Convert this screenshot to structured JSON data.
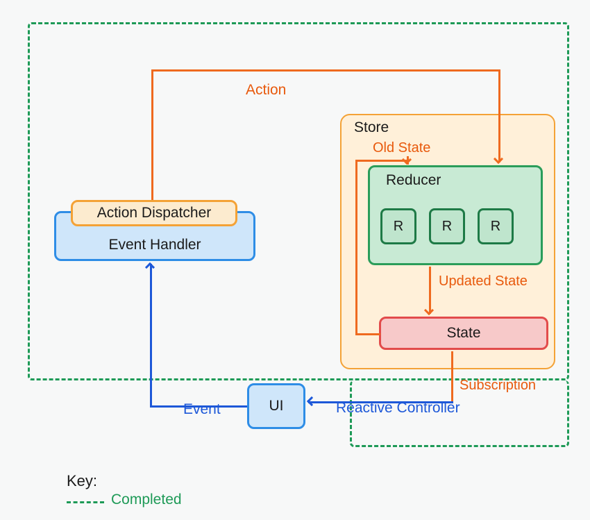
{
  "colors": {
    "green_dash": "#1e9a57",
    "orange": "#ef6a1f",
    "orange_text": "#e8590c",
    "store_border": "#f4a236",
    "store_fill": "#fff0d9",
    "blue_border": "#2e8de6",
    "blue_fill": "#cfe6fa",
    "blue_text": "#1d58d8",
    "dispatcher_border": "#f4a236",
    "dispatcher_fill": "#fcebcf",
    "reducer_border": "#2a9d5a",
    "reducer_fill": "#c8ead4",
    "reducer_inner_border": "#1e7a46",
    "reducer_inner_fill": "#bfe5cd",
    "state_border": "#e24b4b",
    "state_fill": "#f7c9c9",
    "text": "#1a1a1a"
  },
  "labels": {
    "action": "Action",
    "store": "Store",
    "old_state": "Old State",
    "reducer": "Reducer",
    "reducer_r": "R",
    "action_dispatcher": "Action Dispatcher",
    "event_handler": "Event Handler",
    "updated_state": "Updated State",
    "state": "State",
    "subscription": "Subscription",
    "ui": "UI",
    "event": "Event",
    "reactive_controller": "Reactive Controller",
    "key_title": "Key:",
    "completed": "Completed"
  }
}
